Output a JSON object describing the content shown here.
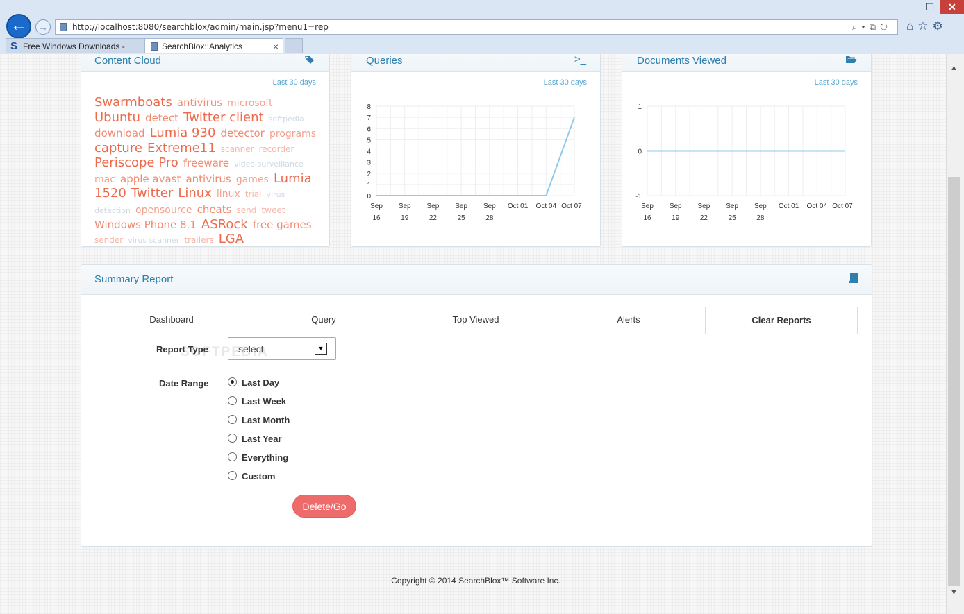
{
  "browser": {
    "url": "http://localhost:8080/searchblox/admin/main.jsp?menu1=rep",
    "tabs": [
      {
        "label": "Free Windows Downloads - So..."
      },
      {
        "label": "SearchBlox::Analytics"
      }
    ],
    "window_controls": {
      "minimize": "—",
      "maximize": "☐",
      "close": "✕"
    }
  },
  "panels": {
    "content_cloud": {
      "title": "Content Cloud",
      "period": "Last 30 days",
      "icon": "tags-icon",
      "tags": [
        {
          "text": "Swarmboats",
          "size": 1
        },
        {
          "text": "antivirus",
          "size": 2
        },
        {
          "text": "microsoft",
          "size": 3
        },
        {
          "text": "Ubuntu",
          "size": 1
        },
        {
          "text": "detect",
          "size": 2
        },
        {
          "text": "Twitter client",
          "size": 1
        },
        {
          "text": "softpedia",
          "size": 5
        },
        {
          "text": "download",
          "size": 2
        },
        {
          "text": "Lumia 930",
          "size": 1
        },
        {
          "text": "detector",
          "size": 2
        },
        {
          "text": "programs",
          "size": 3
        },
        {
          "text": "capture",
          "size": 1
        },
        {
          "text": "Extreme11",
          "size": 1
        },
        {
          "text": "scanner",
          "size": 4
        },
        {
          "text": "recorder",
          "size": 4
        },
        {
          "text": "Periscope Pro",
          "size": 1
        },
        {
          "text": "freeware",
          "size": 2
        },
        {
          "text": "video surveillance",
          "size": 5
        },
        {
          "text": "mac",
          "size": 3
        },
        {
          "text": "apple avast",
          "size": 2
        },
        {
          "text": "antivirus",
          "size": 2
        },
        {
          "text": "games",
          "size": 3
        },
        {
          "text": "Lumia 1520",
          "size": 1
        },
        {
          "text": "Twitter",
          "size": 1
        },
        {
          "text": "Linux",
          "size": 1
        },
        {
          "text": "linux",
          "size": 3
        },
        {
          "text": "trial",
          "size": 4
        },
        {
          "text": "virus detection",
          "size": 5
        },
        {
          "text": "opensource",
          "size": 3
        },
        {
          "text": "cheats",
          "size": 2
        },
        {
          "text": "send",
          "size": 4
        },
        {
          "text": "tweet",
          "size": 4
        },
        {
          "text": "Windows Phone 8.1",
          "size": 2
        },
        {
          "text": "ASRock",
          "size": 1
        },
        {
          "text": "free games",
          "size": 2
        },
        {
          "text": "sender",
          "size": 4
        },
        {
          "text": "virus scanner",
          "size": 5
        },
        {
          "text": "trailers",
          "size": 4
        },
        {
          "text": "LGA",
          "size": 1
        }
      ]
    },
    "queries": {
      "title": "Queries",
      "period": "Last 30 days",
      "icon": "terminal-icon"
    },
    "documents_viewed": {
      "title": "Documents Viewed",
      "period": "Last 30 days",
      "icon": "folder-open-icon"
    }
  },
  "chart_data": [
    {
      "type": "line",
      "x": [
        "Sep 16",
        "Sep 19",
        "Sep 22",
        "Sep 25",
        "Sep 28",
        "Oct 01",
        "Oct 04",
        "Oct 07"
      ],
      "series": [
        {
          "values": [
            0,
            0,
            0,
            0,
            0,
            0,
            0,
            7
          ]
        }
      ],
      "ylim": [
        0,
        8
      ],
      "yticks": [
        0,
        1,
        2,
        3,
        4,
        5,
        6,
        7,
        8
      ],
      "grid": true,
      "color": "#8fcbe8"
    },
    {
      "type": "line",
      "x": [
        "Sep 16",
        "Sep 19",
        "Sep 22",
        "Sep 25",
        "Sep 28",
        "Oct 01",
        "Oct 04",
        "Oct 07"
      ],
      "series": [
        {
          "values": [
            0,
            0,
            0,
            0,
            0,
            0,
            0,
            0
          ]
        }
      ],
      "ylim": [
        -1,
        1
      ],
      "yticks": [
        -1,
        0,
        1
      ],
      "grid": true,
      "color": "#8fcbe8"
    }
  ],
  "summary": {
    "title": "Summary Report",
    "icon": "book-icon",
    "tabs": [
      {
        "label": "Dashboard"
      },
      {
        "label": "Query"
      },
      {
        "label": "Top Viewed"
      },
      {
        "label": "Alerts"
      },
      {
        "label": "Clear Reports"
      }
    ],
    "active_tab": "Clear Reports",
    "report_type_label": "Report Type",
    "report_type_value": "select",
    "date_range_label": "Date Range",
    "date_options": [
      {
        "label": "Last Day",
        "checked": true
      },
      {
        "label": "Last Week",
        "checked": false
      },
      {
        "label": "Last Month",
        "checked": false
      },
      {
        "label": "Last Year",
        "checked": false
      },
      {
        "label": "Everything",
        "checked": false
      },
      {
        "label": "Custom",
        "checked": false
      }
    ],
    "submit_label": "Delete/Go"
  },
  "watermark": "SOFTPEDIA",
  "footer": {
    "copyright": "Copyright © 2014 SearchBlox™ Software Inc."
  }
}
